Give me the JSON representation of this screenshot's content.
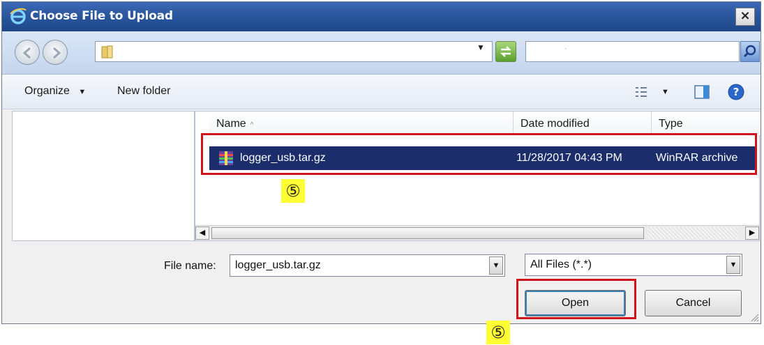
{
  "window": {
    "title": "Choose File to Upload",
    "close_label": "×"
  },
  "address": {
    "path_value": "",
    "search_placeholder": "·"
  },
  "toolbar": {
    "organize_label": "Organize",
    "new_folder_label": "New folder"
  },
  "file_list": {
    "columns": [
      "Name",
      "Date modified",
      "Type"
    ],
    "sort_indicator": "^",
    "rows": [
      {
        "name": "logger_usb.tar.gz",
        "date_modified": "11/28/2017 04:43 PM",
        "type": "WinRAR archive"
      }
    ]
  },
  "footer": {
    "file_name_label": "File name:",
    "file_name_value": "logger_usb.tar.gz",
    "filter_value": "All Files (*.*)",
    "open_label": "Open",
    "cancel_label": "Cancel"
  },
  "annotations": {
    "step_marker": "⑤"
  },
  "colors": {
    "selection": "#1b2d6b",
    "highlight_box": "#d0141c",
    "badge": "#ffff33",
    "title_bar": "#2a579e"
  },
  "icons": [
    "ie-icon",
    "back-arrow-icon",
    "forward-arrow-icon",
    "folder-icon",
    "chevron-down-icon",
    "refresh-icon",
    "search-icon",
    "view-options-icon",
    "preview-pane-icon",
    "help-icon",
    "archive-file-icon",
    "resize-grip-icon"
  ]
}
